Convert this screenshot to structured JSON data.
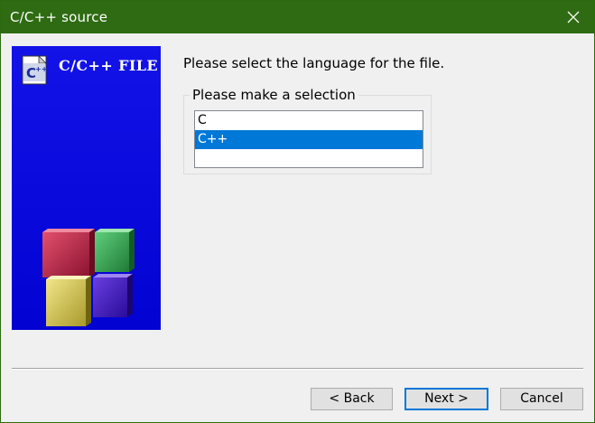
{
  "window": {
    "title": "C/C++ source"
  },
  "side_panel": {
    "title": "C/C++ FILE",
    "icon_label": "C++"
  },
  "main": {
    "prompt": "Please select the language for the file.",
    "group_title": "Please make a selection",
    "languages": [
      {
        "label": "C",
        "selected": false
      },
      {
        "label": "C++",
        "selected": true
      }
    ]
  },
  "buttons": {
    "back": "< Back",
    "next": "Next >",
    "cancel": "Cancel"
  },
  "colors": {
    "titlebar": "#2e6b12",
    "panel": "#0a0ae0",
    "selection": "#0078d7"
  }
}
